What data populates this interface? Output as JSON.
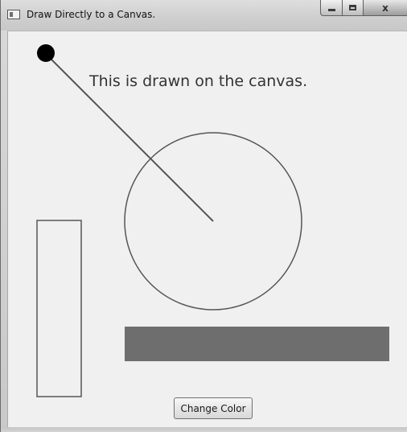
{
  "window": {
    "title": "Draw Directly to a Canvas.",
    "controls": {
      "minimize": "minimize",
      "maximize": "maximize",
      "close": "x"
    }
  },
  "canvas": {
    "text": "This is drawn on the canvas.",
    "shapes": [
      "line",
      "small-filled-circle",
      "circle",
      "rectangle",
      "filled-rectangle"
    ],
    "colors": {
      "stroke": "#555555",
      "fill_bar": "#6e6e6e",
      "dot": "#000000",
      "background": "#f0f0f0"
    }
  },
  "button": {
    "label": "Change Color"
  }
}
